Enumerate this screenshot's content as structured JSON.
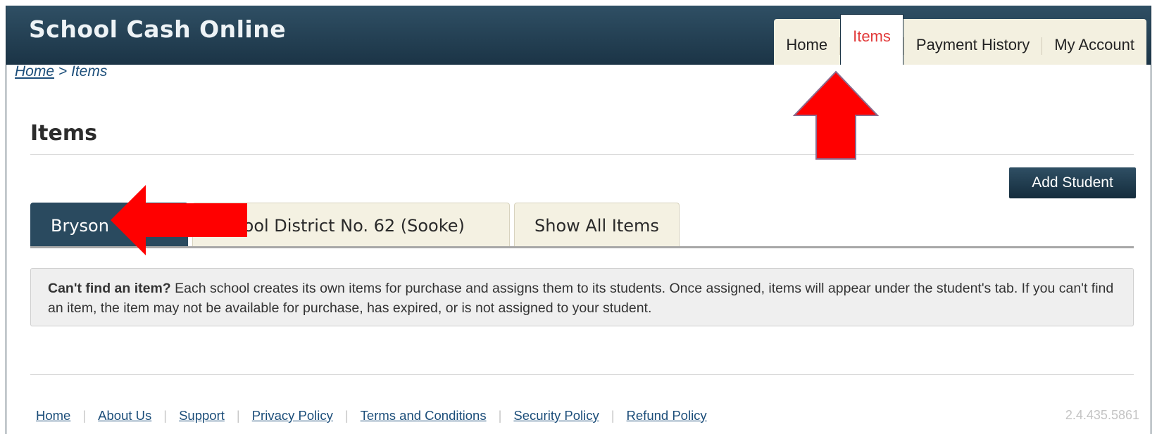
{
  "header": {
    "brand": "School Cash Online"
  },
  "topnav": {
    "items": [
      {
        "label": "Home",
        "active": false
      },
      {
        "label": "Items",
        "active": true
      },
      {
        "label": "Payment History",
        "active": false
      },
      {
        "label": "My Account",
        "active": false
      }
    ]
  },
  "breadcrumb": {
    "home": "Home",
    "separator": ">",
    "current": "Items"
  },
  "page": {
    "title": "Items",
    "add_student_label": "Add Student"
  },
  "tabs": [
    {
      "label": "Bryson",
      "active": true
    },
    {
      "label": "School District No. 62 (Sooke)",
      "active": false
    },
    {
      "label": "Show All Items",
      "active": false
    }
  ],
  "notice": {
    "heading": "Can't find an item?",
    "body": "Each school creates its own items for purchase and assigns them to its students. Once assigned, items will appear under the student's tab. If you can't find an item, the item may not be available for purchase, has expired, or is not assigned to your student."
  },
  "footer": {
    "links": [
      "Home",
      "About Us",
      "Support",
      "Privacy Policy",
      "Terms and Conditions",
      "Security Policy",
      "Refund Policy"
    ],
    "version": "2.4.435.5861"
  },
  "colors": {
    "header": "#1b3446",
    "accent_red": "#e23a3a",
    "arrow_red": "#ff0000",
    "tab_bg": "#f4f1e2"
  }
}
